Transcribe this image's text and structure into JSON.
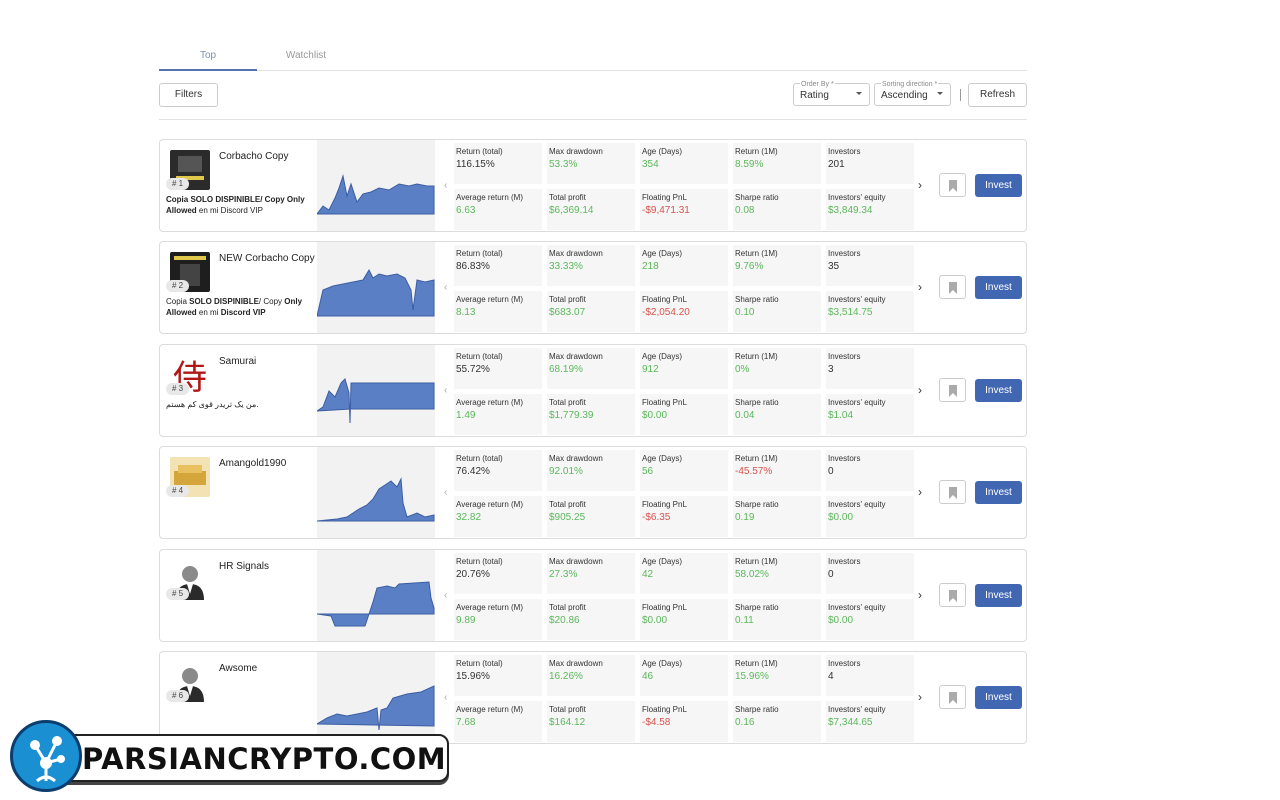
{
  "tabs": [
    {
      "label": "Top",
      "active": true
    },
    {
      "label": "Watchlist",
      "active": false
    }
  ],
  "toolbar": {
    "filters_label": "Filters",
    "order_by": {
      "label": "Order By *",
      "value": "Rating"
    },
    "sorting_direction": {
      "label": "Sorting direction *",
      "value": "Ascending"
    },
    "refresh_label": "Refresh"
  },
  "stat_labels": {
    "return_total": "Return (total)",
    "max_drawdown": "Max drawdown",
    "age_days": "Age (Days)",
    "return_1m": "Return (1M)",
    "investors": "Investors",
    "average_return_m": "Average return (M)",
    "total_profit": "Total profit",
    "floating_pnl": "Floating PnL",
    "sharpe_ratio": "Sharpe ratio",
    "investors_equity": "Investors' equity"
  },
  "invest_label": "Invest",
  "watermark": "PARSIANCRYPTO.COM",
  "colors": {
    "accent": "#4267b2",
    "positive": "#5cb85c",
    "negative": "#d9534f",
    "chart_fill": "#5b7fc4"
  },
  "traders": [
    {
      "rank": "# 1",
      "name": "Corbacho Copy",
      "desc_html": "<b>Copia SOLO DISPINIBLE/ Copy Only Allowed</b> en mi Discord VIP",
      "return_total": "116.15%",
      "max_drawdown": "53.3%",
      "age_days": "354",
      "return_1m": "8.59%",
      "investors": "201",
      "average_return_m": "6.63",
      "total_profit": "$6,369.14",
      "floating_pnl": "-$9,471.31",
      "sharpe_ratio": "0.08",
      "investors_equity": "$3,849.34",
      "return_1m_neg": false,
      "floating_neg": true
    },
    {
      "rank": "# 2",
      "name": "NEW Corbacho Copy",
      "desc_html": "Copia <b>SOLO DISPINIBLE</b>/ Copy <b>Only Allowed</b> en mi <b>Discord VIP</b>",
      "return_total": "86.83%",
      "max_drawdown": "33.33%",
      "age_days": "218",
      "return_1m": "9.76%",
      "investors": "35",
      "average_return_m": "8.13",
      "total_profit": "$683.07",
      "floating_pnl": "-$2,054.20",
      "sharpe_ratio": "0.10",
      "investors_equity": "$3,514.75",
      "return_1m_neg": false,
      "floating_neg": true
    },
    {
      "rank": "# 3",
      "name": "Samurai",
      "desc_html": "من یک تریدر قوی کم هستم.",
      "return_total": "55.72%",
      "max_drawdown": "68.19%",
      "age_days": "912",
      "return_1m": "0%",
      "investors": "3",
      "average_return_m": "1.49",
      "total_profit": "$1,779.39",
      "floating_pnl": "$0.00",
      "sharpe_ratio": "0.04",
      "investors_equity": "$1.04",
      "return_1m_neg": false,
      "floating_neg": false
    },
    {
      "rank": "# 4",
      "name": "Amangold1990",
      "desc_html": "",
      "return_total": "76.42%",
      "max_drawdown": "92.01%",
      "age_days": "56",
      "return_1m": "-45.57%",
      "investors": "0",
      "average_return_m": "32.82",
      "total_profit": "$905.25",
      "floating_pnl": "-$6.35",
      "sharpe_ratio": "0.19",
      "investors_equity": "$0.00",
      "return_1m_neg": true,
      "floating_neg": true
    },
    {
      "rank": "# 5",
      "name": "HR Signals",
      "desc_html": "",
      "return_total": "20.76%",
      "max_drawdown": "27.3%",
      "age_days": "42",
      "return_1m": "58.02%",
      "investors": "0",
      "average_return_m": "9.89",
      "total_profit": "$20.86",
      "floating_pnl": "$0.00",
      "sharpe_ratio": "0.11",
      "investors_equity": "$0.00",
      "return_1m_neg": false,
      "floating_neg": false
    },
    {
      "rank": "# 6",
      "name": "Awsome",
      "desc_html": "",
      "return_total": "15.96%",
      "max_drawdown": "16.26%",
      "age_days": "46",
      "return_1m": "15.96%",
      "investors": "4",
      "average_return_m": "7.68",
      "total_profit": "$164.12",
      "floating_pnl": "-$4.58",
      "sharpe_ratio": "0.16",
      "investors_equity": "$7,344.65",
      "return_1m_neg": false,
      "floating_neg": true
    }
  ]
}
